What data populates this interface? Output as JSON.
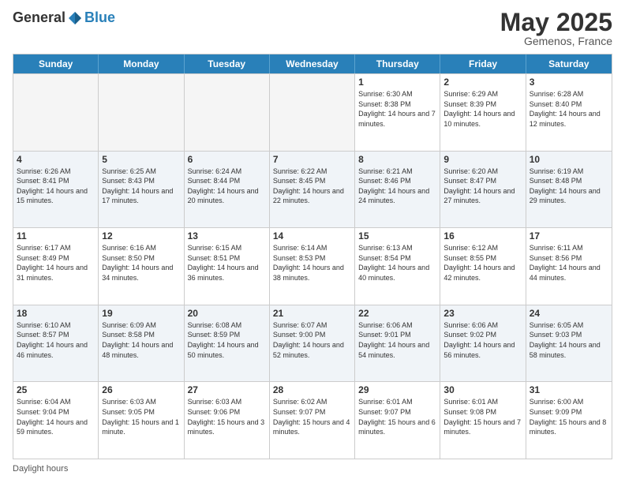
{
  "logo": {
    "general": "General",
    "blue": "Blue"
  },
  "header": {
    "month": "May 2025",
    "location": "Gemenos, France"
  },
  "weekdays": [
    "Sunday",
    "Monday",
    "Tuesday",
    "Wednesday",
    "Thursday",
    "Friday",
    "Saturday"
  ],
  "weeks": [
    [
      {
        "day": "",
        "info": "",
        "empty": true
      },
      {
        "day": "",
        "info": "",
        "empty": true
      },
      {
        "day": "",
        "info": "",
        "empty": true
      },
      {
        "day": "",
        "info": "",
        "empty": true
      },
      {
        "day": "1",
        "info": "Sunrise: 6:30 AM\nSunset: 8:38 PM\nDaylight: 14 hours\nand 7 minutes."
      },
      {
        "day": "2",
        "info": "Sunrise: 6:29 AM\nSunset: 8:39 PM\nDaylight: 14 hours\nand 10 minutes."
      },
      {
        "day": "3",
        "info": "Sunrise: 6:28 AM\nSunset: 8:40 PM\nDaylight: 14 hours\nand 12 minutes."
      }
    ],
    [
      {
        "day": "4",
        "info": "Sunrise: 6:26 AM\nSunset: 8:41 PM\nDaylight: 14 hours\nand 15 minutes."
      },
      {
        "day": "5",
        "info": "Sunrise: 6:25 AM\nSunset: 8:43 PM\nDaylight: 14 hours\nand 17 minutes."
      },
      {
        "day": "6",
        "info": "Sunrise: 6:24 AM\nSunset: 8:44 PM\nDaylight: 14 hours\nand 20 minutes."
      },
      {
        "day": "7",
        "info": "Sunrise: 6:22 AM\nSunset: 8:45 PM\nDaylight: 14 hours\nand 22 minutes."
      },
      {
        "day": "8",
        "info": "Sunrise: 6:21 AM\nSunset: 8:46 PM\nDaylight: 14 hours\nand 24 minutes."
      },
      {
        "day": "9",
        "info": "Sunrise: 6:20 AM\nSunset: 8:47 PM\nDaylight: 14 hours\nand 27 minutes."
      },
      {
        "day": "10",
        "info": "Sunrise: 6:19 AM\nSunset: 8:48 PM\nDaylight: 14 hours\nand 29 minutes."
      }
    ],
    [
      {
        "day": "11",
        "info": "Sunrise: 6:17 AM\nSunset: 8:49 PM\nDaylight: 14 hours\nand 31 minutes."
      },
      {
        "day": "12",
        "info": "Sunrise: 6:16 AM\nSunset: 8:50 PM\nDaylight: 14 hours\nand 34 minutes."
      },
      {
        "day": "13",
        "info": "Sunrise: 6:15 AM\nSunset: 8:51 PM\nDaylight: 14 hours\nand 36 minutes."
      },
      {
        "day": "14",
        "info": "Sunrise: 6:14 AM\nSunset: 8:53 PM\nDaylight: 14 hours\nand 38 minutes."
      },
      {
        "day": "15",
        "info": "Sunrise: 6:13 AM\nSunset: 8:54 PM\nDaylight: 14 hours\nand 40 minutes."
      },
      {
        "day": "16",
        "info": "Sunrise: 6:12 AM\nSunset: 8:55 PM\nDaylight: 14 hours\nand 42 minutes."
      },
      {
        "day": "17",
        "info": "Sunrise: 6:11 AM\nSunset: 8:56 PM\nDaylight: 14 hours\nand 44 minutes."
      }
    ],
    [
      {
        "day": "18",
        "info": "Sunrise: 6:10 AM\nSunset: 8:57 PM\nDaylight: 14 hours\nand 46 minutes."
      },
      {
        "day": "19",
        "info": "Sunrise: 6:09 AM\nSunset: 8:58 PM\nDaylight: 14 hours\nand 48 minutes."
      },
      {
        "day": "20",
        "info": "Sunrise: 6:08 AM\nSunset: 8:59 PM\nDaylight: 14 hours\nand 50 minutes."
      },
      {
        "day": "21",
        "info": "Sunrise: 6:07 AM\nSunset: 9:00 PM\nDaylight: 14 hours\nand 52 minutes."
      },
      {
        "day": "22",
        "info": "Sunrise: 6:06 AM\nSunset: 9:01 PM\nDaylight: 14 hours\nand 54 minutes."
      },
      {
        "day": "23",
        "info": "Sunrise: 6:06 AM\nSunset: 9:02 PM\nDaylight: 14 hours\nand 56 minutes."
      },
      {
        "day": "24",
        "info": "Sunrise: 6:05 AM\nSunset: 9:03 PM\nDaylight: 14 hours\nand 58 minutes."
      }
    ],
    [
      {
        "day": "25",
        "info": "Sunrise: 6:04 AM\nSunset: 9:04 PM\nDaylight: 14 hours\nand 59 minutes."
      },
      {
        "day": "26",
        "info": "Sunrise: 6:03 AM\nSunset: 9:05 PM\nDaylight: 15 hours\nand 1 minute."
      },
      {
        "day": "27",
        "info": "Sunrise: 6:03 AM\nSunset: 9:06 PM\nDaylight: 15 hours\nand 3 minutes."
      },
      {
        "day": "28",
        "info": "Sunrise: 6:02 AM\nSunset: 9:07 PM\nDaylight: 15 hours\nand 4 minutes."
      },
      {
        "day": "29",
        "info": "Sunrise: 6:01 AM\nSunset: 9:07 PM\nDaylight: 15 hours\nand 6 minutes."
      },
      {
        "day": "30",
        "info": "Sunrise: 6:01 AM\nSunset: 9:08 PM\nDaylight: 15 hours\nand 7 minutes."
      },
      {
        "day": "31",
        "info": "Sunrise: 6:00 AM\nSunset: 9:09 PM\nDaylight: 15 hours\nand 8 minutes."
      }
    ]
  ],
  "footer": {
    "label": "Daylight hours"
  }
}
